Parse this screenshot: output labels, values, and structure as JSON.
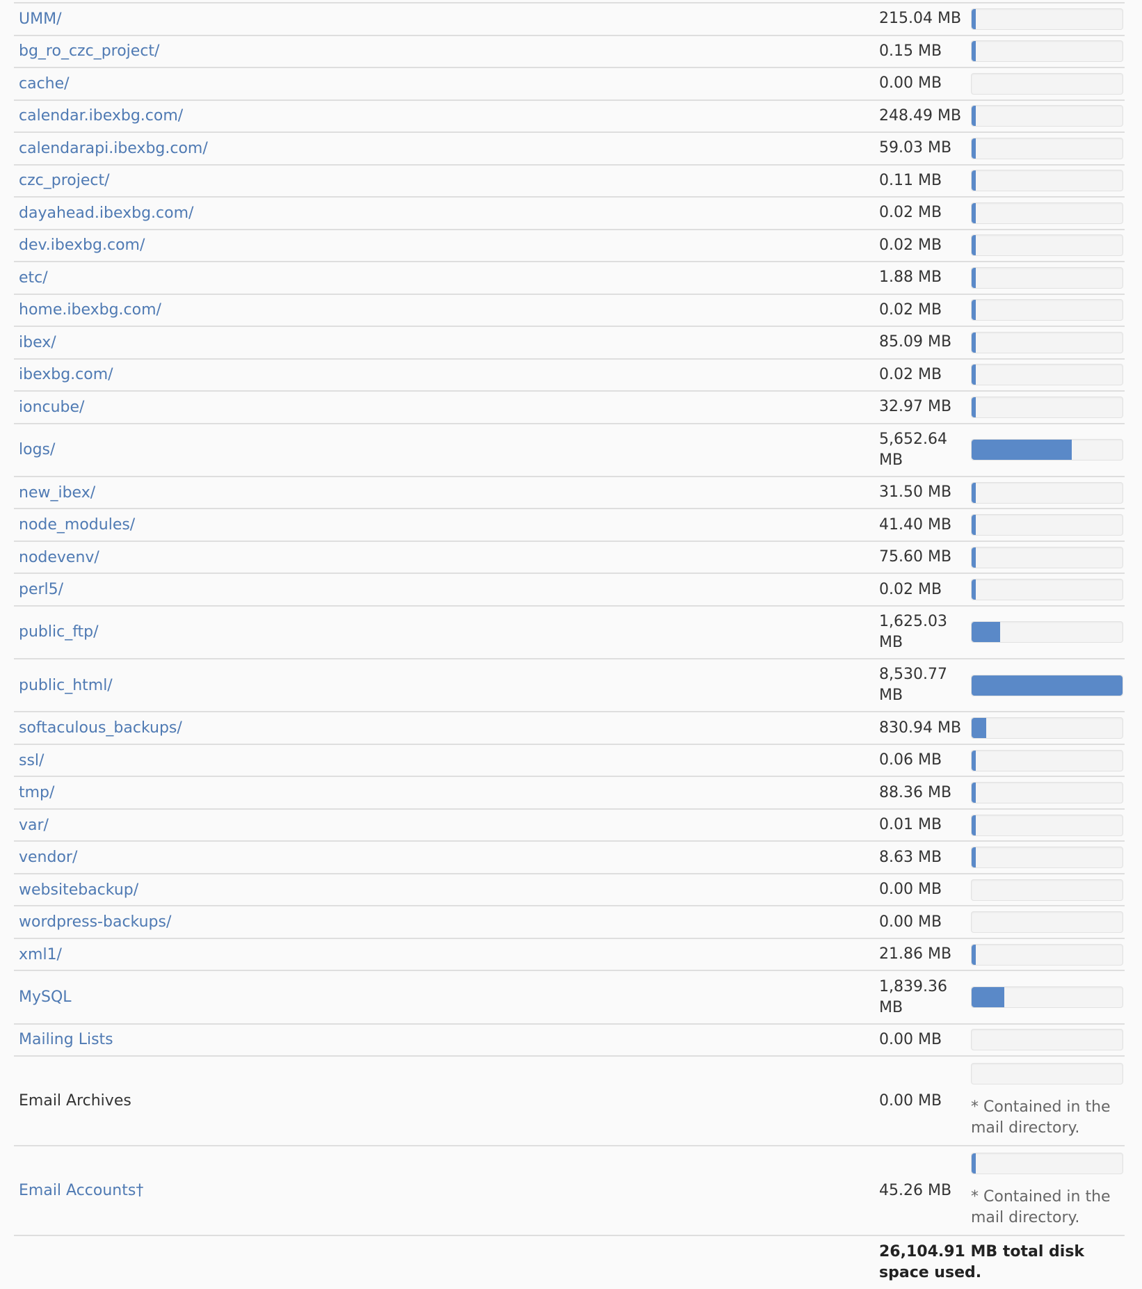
{
  "colors": {
    "link": "#4f7ab3",
    "bar_fill": "#5a89c8",
    "bar_track": "#f4f4f4",
    "row_border": "#dedede"
  },
  "max_mb": 8530.77,
  "rows": [
    {
      "name": "UMM/",
      "size": "215.04 MB",
      "mb": 215.04,
      "link": true
    },
    {
      "name": "bg_ro_czc_project/",
      "size": "0.15 MB",
      "mb": 0.15,
      "link": true
    },
    {
      "name": "cache/",
      "size": "0.00 MB",
      "mb": 0.0,
      "link": true
    },
    {
      "name": "calendar.ibexbg.com/",
      "size": "248.49 MB",
      "mb": 248.49,
      "link": true
    },
    {
      "name": "calendarapi.ibexbg.com/",
      "size": "59.03 MB",
      "mb": 59.03,
      "link": true
    },
    {
      "name": "czc_project/",
      "size": "0.11 MB",
      "mb": 0.11,
      "link": true
    },
    {
      "name": "dayahead.ibexbg.com/",
      "size": "0.02 MB",
      "mb": 0.02,
      "link": true
    },
    {
      "name": "dev.ibexbg.com/",
      "size": "0.02 MB",
      "mb": 0.02,
      "link": true
    },
    {
      "name": "etc/",
      "size": "1.88 MB",
      "mb": 1.88,
      "link": true
    },
    {
      "name": "home.ibexbg.com/",
      "size": "0.02 MB",
      "mb": 0.02,
      "link": true
    },
    {
      "name": "ibex/",
      "size": "85.09 MB",
      "mb": 85.09,
      "link": true
    },
    {
      "name": "ibexbg.com/",
      "size": "0.02 MB",
      "mb": 0.02,
      "link": true
    },
    {
      "name": "ioncube/",
      "size": "32.97 MB",
      "mb": 32.97,
      "link": true
    },
    {
      "name": "logs/",
      "size": "5,652.64 MB",
      "mb": 5652.64,
      "link": true,
      "tall": true
    },
    {
      "name": "new_ibex/",
      "size": "31.50 MB",
      "mb": 31.5,
      "link": true
    },
    {
      "name": "node_modules/",
      "size": "41.40 MB",
      "mb": 41.4,
      "link": true
    },
    {
      "name": "nodevenv/",
      "size": "75.60 MB",
      "mb": 75.6,
      "link": true
    },
    {
      "name": "perl5/",
      "size": "0.02 MB",
      "mb": 0.02,
      "link": true
    },
    {
      "name": "public_ftp/",
      "size": "1,625.03 MB",
      "mb": 1625.03,
      "link": true,
      "tall": true
    },
    {
      "name": "public_html/",
      "size": "8,530.77 MB",
      "mb": 8530.77,
      "link": true,
      "tall": true
    },
    {
      "name": "softaculous_backups/",
      "size": "830.94 MB",
      "mb": 830.94,
      "link": true
    },
    {
      "name": "ssl/",
      "size": "0.06 MB",
      "mb": 0.06,
      "link": true
    },
    {
      "name": "tmp/",
      "size": "88.36 MB",
      "mb": 88.36,
      "link": true
    },
    {
      "name": "var/",
      "size": "0.01 MB",
      "mb": 0.01,
      "link": true
    },
    {
      "name": "vendor/",
      "size": "8.63 MB",
      "mb": 8.63,
      "link": true
    },
    {
      "name": "websitebackup/",
      "size": "0.00 MB",
      "mb": 0.0,
      "link": true
    },
    {
      "name": "wordpress-backups/",
      "size": "0.00 MB",
      "mb": 0.0,
      "link": true
    },
    {
      "name": "xml1/",
      "size": "21.86 MB",
      "mb": 21.86,
      "link": true
    },
    {
      "name": "MySQL",
      "size": "1,839.36 MB",
      "mb": 1839.36,
      "link": true,
      "tall": true
    },
    {
      "name": "Mailing Lists",
      "size": "0.00 MB",
      "mb": 0.0,
      "link": true
    },
    {
      "name": "Email Archives",
      "size": "0.00 MB",
      "mb": 0.0,
      "link": false,
      "note": "* Contained in the mail directory."
    },
    {
      "name": "Email Accounts†",
      "size": "45.26 MB",
      "mb": 45.26,
      "link": true,
      "note": "* Contained in the mail directory."
    }
  ],
  "total": "26,104.91 MB total disk space used."
}
